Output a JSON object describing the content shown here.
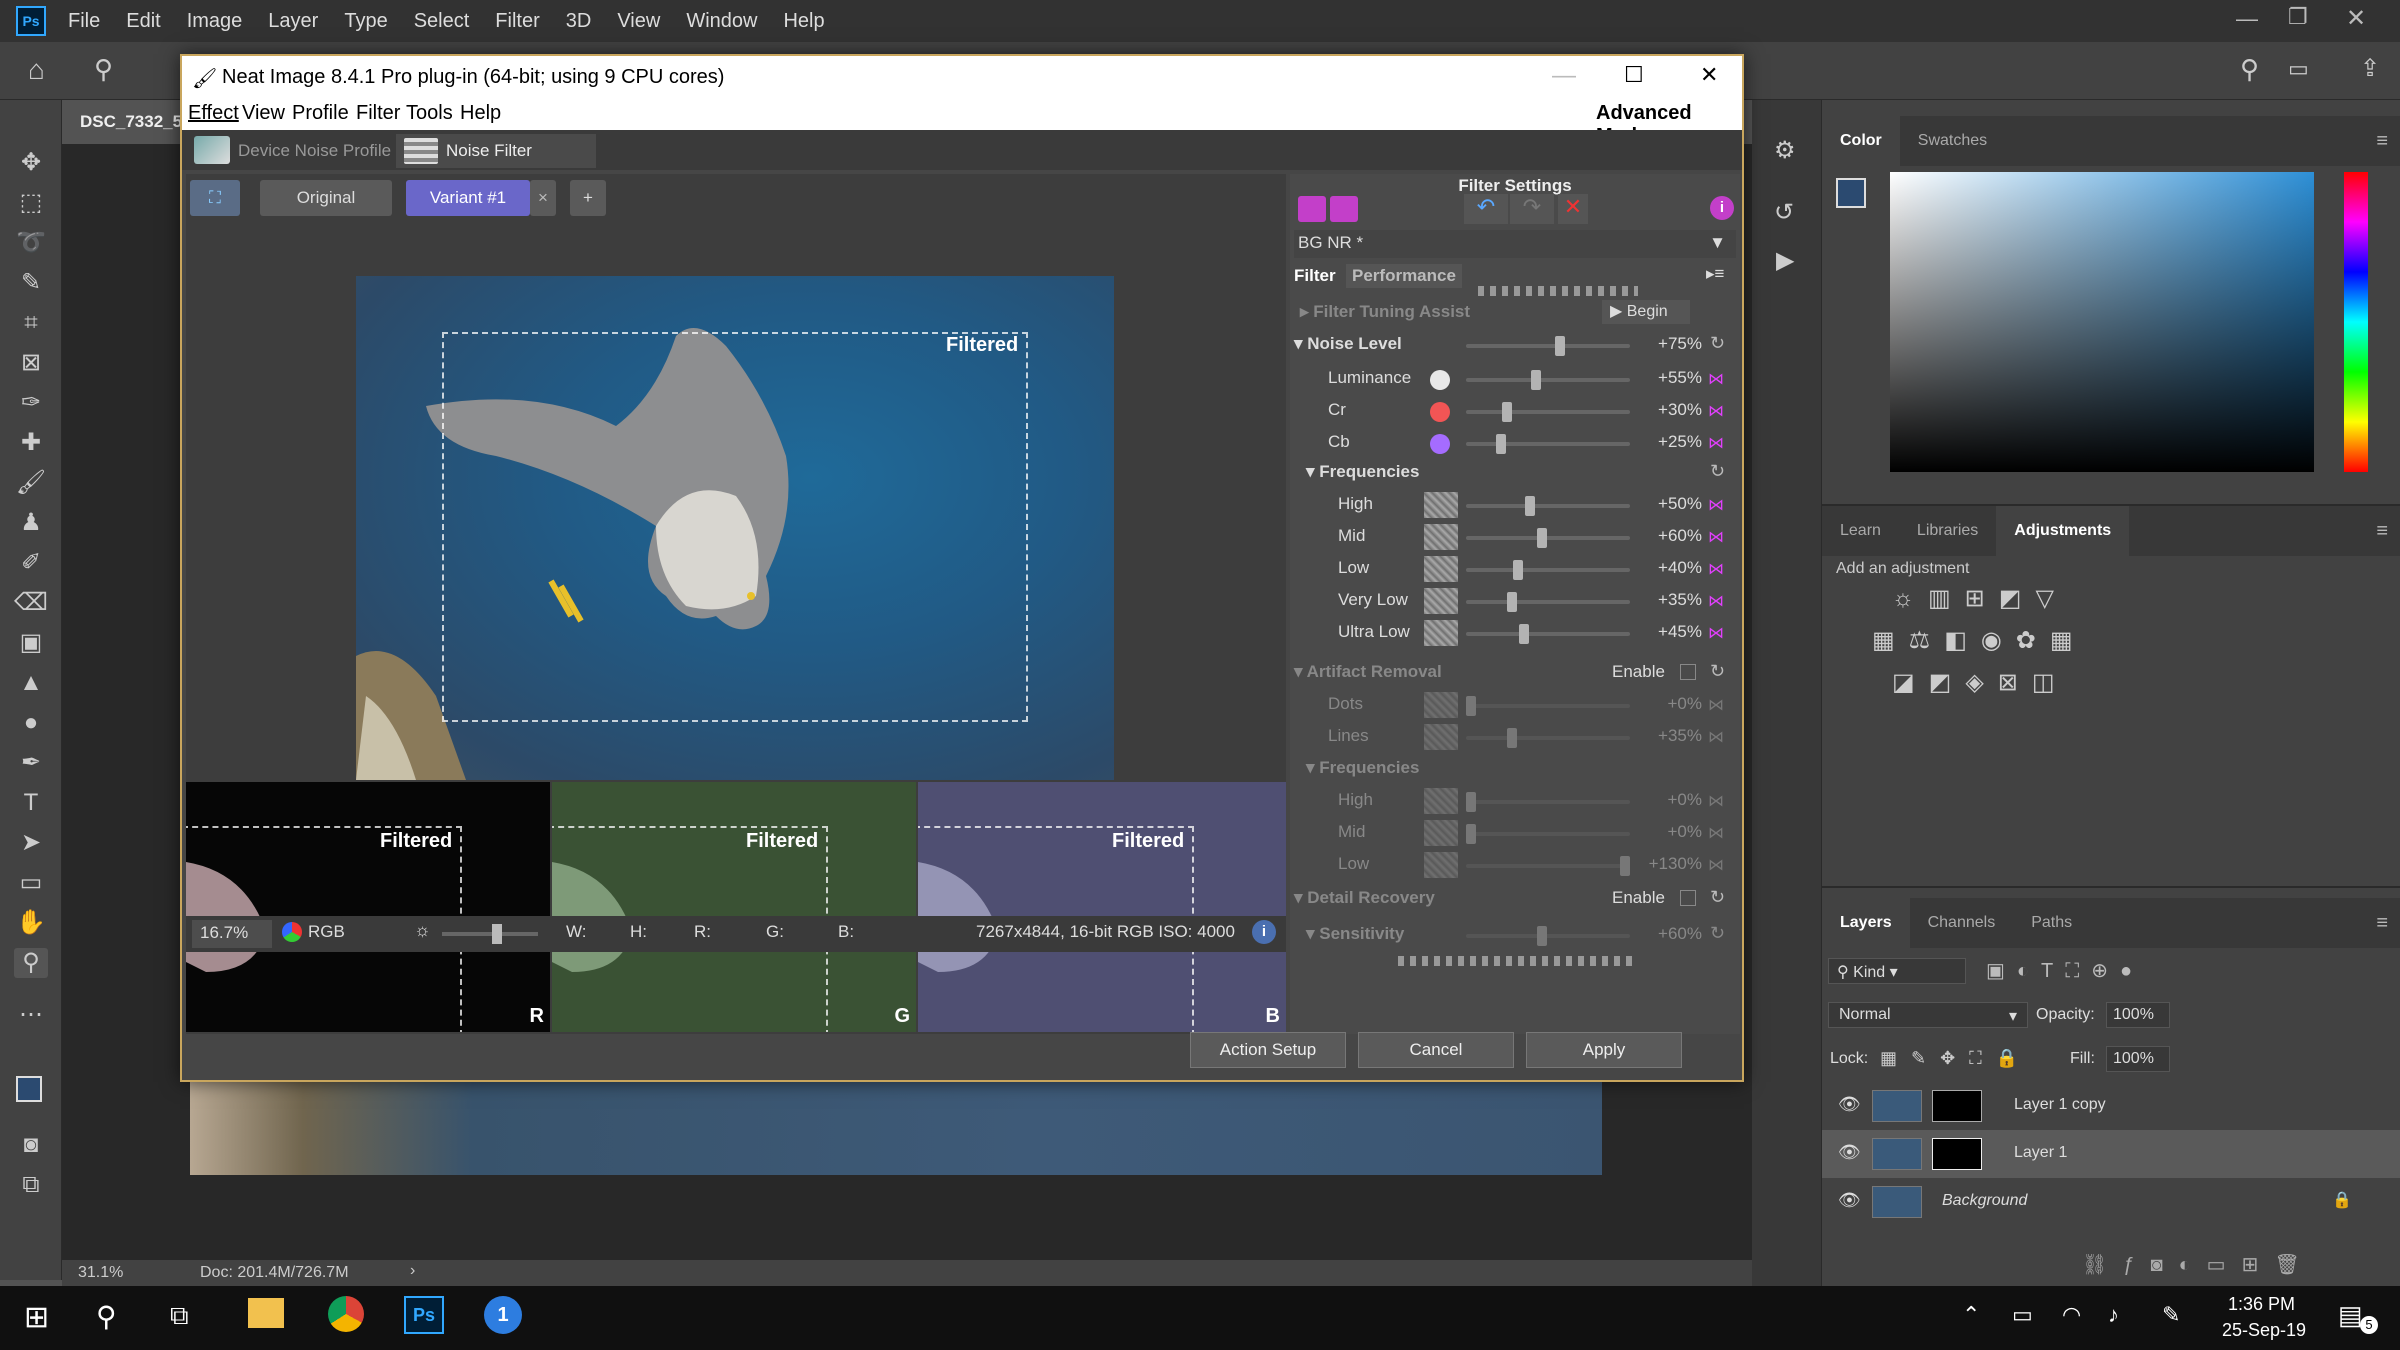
{
  "ps": {
    "menu": [
      "File",
      "Edit",
      "Image",
      "Layer",
      "Type",
      "Select",
      "Filter",
      "3D",
      "View",
      "Window",
      "Help"
    ],
    "logo": "Ps",
    "doc_tab": "DSC_7332_5",
    "status_zoom": "31.1%",
    "status_doc": "Doc: 201.4M/726.7M",
    "status_arrow": "›"
  },
  "color_panel": {
    "tabs": [
      "Color",
      "Swatches"
    ],
    "fg_color": "#2b4a70"
  },
  "adjust_panel": {
    "tabs": [
      "Learn",
      "Libraries",
      "Adjustments"
    ],
    "hint": "Add an adjustment"
  },
  "layers_panel": {
    "tabs": [
      "Layers",
      "Channels",
      "Paths"
    ],
    "kind": "Kind",
    "blend_mode": "Normal",
    "opacity_label": "Opacity:",
    "opacity": "100%",
    "lock_label": "Lock:",
    "fill_label": "Fill:",
    "fill": "100%",
    "layers": [
      "Layer 1 copy",
      "Layer 1",
      "Background"
    ]
  },
  "taskbar": {
    "time": "1:36 PM",
    "date": "25-Sep-19",
    "badge": "5"
  },
  "ni": {
    "title": "Neat Image 8.4.1 Pro plug-in (64-bit; using 9 CPU cores)",
    "menu": [
      "Effect",
      "View",
      "Profile",
      "Filter",
      "Tools",
      "Help"
    ],
    "mode": "Advanced Mode",
    "tab_profile": "Device Noise Profile",
    "tab_filter": "Noise Filter Settings",
    "btn_original": "Original",
    "btn_variant": "Variant #1",
    "btn_variant_close": "×",
    "btn_add": "+",
    "filtered": "Filtered",
    "channels": [
      "R",
      "G",
      "B"
    ],
    "zoom": "16.7%",
    "colorspace": "RGB",
    "readout": [
      "W:",
      "H:",
      "R:",
      "G:",
      "B:"
    ],
    "image_info": "7267x4844, 16-bit RGB ISO: 4000",
    "filter_settings_title": "Filter Settings",
    "preset": "BG NR *",
    "subtabs": [
      "Filter",
      "Performance"
    ],
    "tuning_assist": "Filter Tuning Assist",
    "begin": "Begin",
    "noise_level": "Noise Level",
    "noise_rows": [
      {
        "label": "Luminance",
        "pct": "+55%",
        "val": 0.55,
        "color": "#e8e8e8"
      },
      {
        "label": "Cr",
        "pct": "+30%",
        "val": 0.3,
        "color": "#f25555"
      },
      {
        "label": "Cb",
        "pct": "+25%",
        "val": 0.25,
        "color": "#a56cff"
      }
    ],
    "noise_level_pct": "+75%",
    "noise_level_val": 0.75,
    "frequencies": "Frequencies",
    "freq_rows": [
      {
        "label": "High",
        "pct": "+50%",
        "val": 0.5
      },
      {
        "label": "Mid",
        "pct": "+60%",
        "val": 0.6
      },
      {
        "label": "Low",
        "pct": "+40%",
        "val": 0.4
      },
      {
        "label": "Very Low",
        "pct": "+35%",
        "val": 0.35
      },
      {
        "label": "Ultra Low",
        "pct": "+45%",
        "val": 0.45
      }
    ],
    "artifact_removal": "Artifact Removal",
    "enable": "Enable",
    "artifact_rows": [
      {
        "label": "Dots",
        "pct": "+0%",
        "val": 0.0
      },
      {
        "label": "Lines",
        "pct": "+35%",
        "val": 0.35
      }
    ],
    "artifact_freq_rows": [
      {
        "label": "High",
        "pct": "+0%",
        "val": 0.0
      },
      {
        "label": "Mid",
        "pct": "+0%",
        "val": 0.0
      },
      {
        "label": "Low",
        "pct": "+130%",
        "val": 1.3
      }
    ],
    "detail_recovery": "Detail Recovery",
    "sensitivity": "Sensitivity",
    "sensitivity_pct": "+60%",
    "sensitivity_val": 0.6,
    "btn_action": "Action Setup",
    "btn_cancel": "Cancel",
    "btn_apply": "Apply"
  }
}
